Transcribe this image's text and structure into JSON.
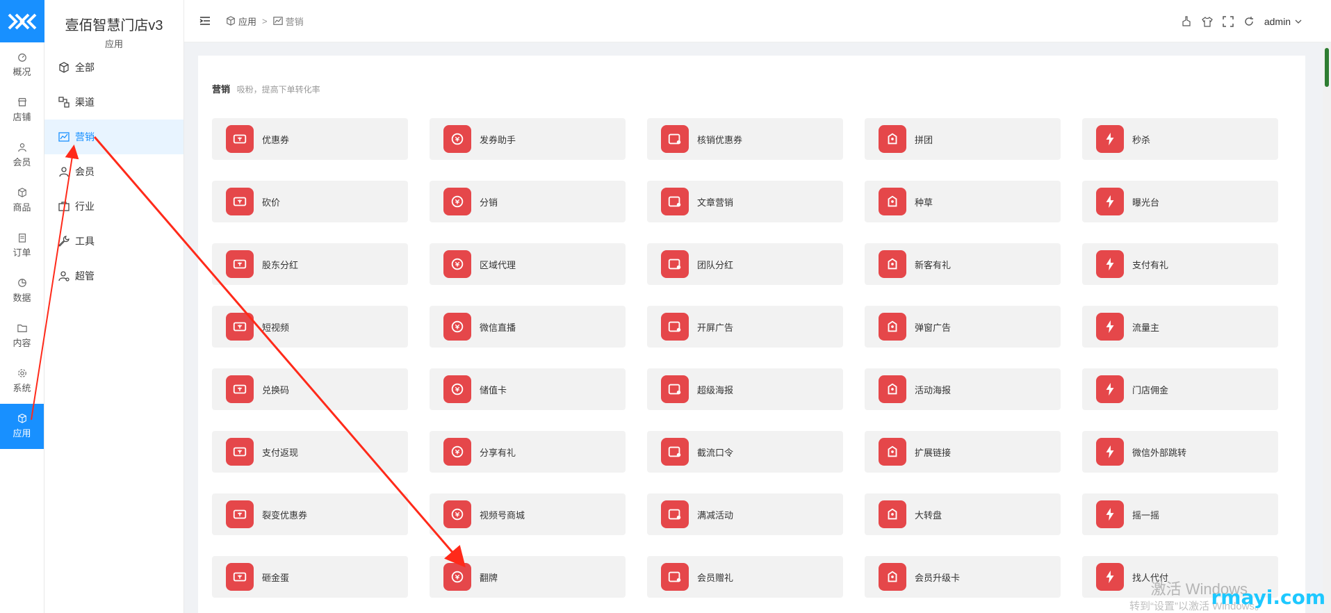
{
  "rail": {
    "items": [
      {
        "label": "概况",
        "icon": "dashboard-icon"
      },
      {
        "label": "店铺",
        "icon": "store-icon"
      },
      {
        "label": "会员",
        "icon": "user-icon"
      },
      {
        "label": "商品",
        "icon": "box-icon"
      },
      {
        "label": "订单",
        "icon": "order-icon"
      },
      {
        "label": "数据",
        "icon": "pie-icon"
      },
      {
        "label": "内容",
        "icon": "folder-icon"
      },
      {
        "label": "系统",
        "icon": "gear-icon"
      },
      {
        "label": "应用",
        "icon": "box-icon"
      }
    ]
  },
  "sub": {
    "brand": "壹佰智慧门店v3",
    "section": "应用",
    "items": [
      {
        "label": "全部"
      },
      {
        "label": "渠道"
      },
      {
        "label": "营销"
      },
      {
        "label": "会员"
      },
      {
        "label": "行业"
      },
      {
        "label": "工具"
      },
      {
        "label": "超管"
      }
    ]
  },
  "header": {
    "crumb1": "应用",
    "sep": ">",
    "crumb2": "营销",
    "user": "admin"
  },
  "section": {
    "title": "营销",
    "subtitle": "吸粉，提高下单转化率"
  },
  "apps": [
    {
      "label": "优惠券"
    },
    {
      "label": "发券助手"
    },
    {
      "label": "核销优惠券"
    },
    {
      "label": "拼团"
    },
    {
      "label": "秒杀"
    },
    {
      "label": "砍价"
    },
    {
      "label": "分销"
    },
    {
      "label": "文章营销"
    },
    {
      "label": "种草"
    },
    {
      "label": "曝光台"
    },
    {
      "label": "股东分红"
    },
    {
      "label": "区域代理"
    },
    {
      "label": "团队分红"
    },
    {
      "label": "新客有礼"
    },
    {
      "label": "支付有礼"
    },
    {
      "label": "短视频"
    },
    {
      "label": "微信直播"
    },
    {
      "label": "开屏广告"
    },
    {
      "label": "弹窗广告"
    },
    {
      "label": "流量主"
    },
    {
      "label": "兑换码"
    },
    {
      "label": "储值卡"
    },
    {
      "label": "超级海报"
    },
    {
      "label": "活动海报"
    },
    {
      "label": "门店佣金"
    },
    {
      "label": "支付返现"
    },
    {
      "label": "分享有礼"
    },
    {
      "label": "截流口令"
    },
    {
      "label": "扩展链接"
    },
    {
      "label": "微信外部跳转"
    },
    {
      "label": "裂变优惠券"
    },
    {
      "label": "视频号商城"
    },
    {
      "label": "满减活动"
    },
    {
      "label": "大转盘"
    },
    {
      "label": "摇一摇"
    },
    {
      "label": "砸金蛋"
    },
    {
      "label": "翻牌"
    },
    {
      "label": "会员赠礼"
    },
    {
      "label": "会员升级卡"
    },
    {
      "label": "找人代付"
    }
  ],
  "watermark": {
    "line1": "激活 Windows",
    "line2": "转到“设置”以激活 Windows。",
    "site": "rmayi.com"
  },
  "colors": {
    "primary": "#1890ff",
    "badge": "#e5474a",
    "arrow": "#ff2a1a"
  }
}
